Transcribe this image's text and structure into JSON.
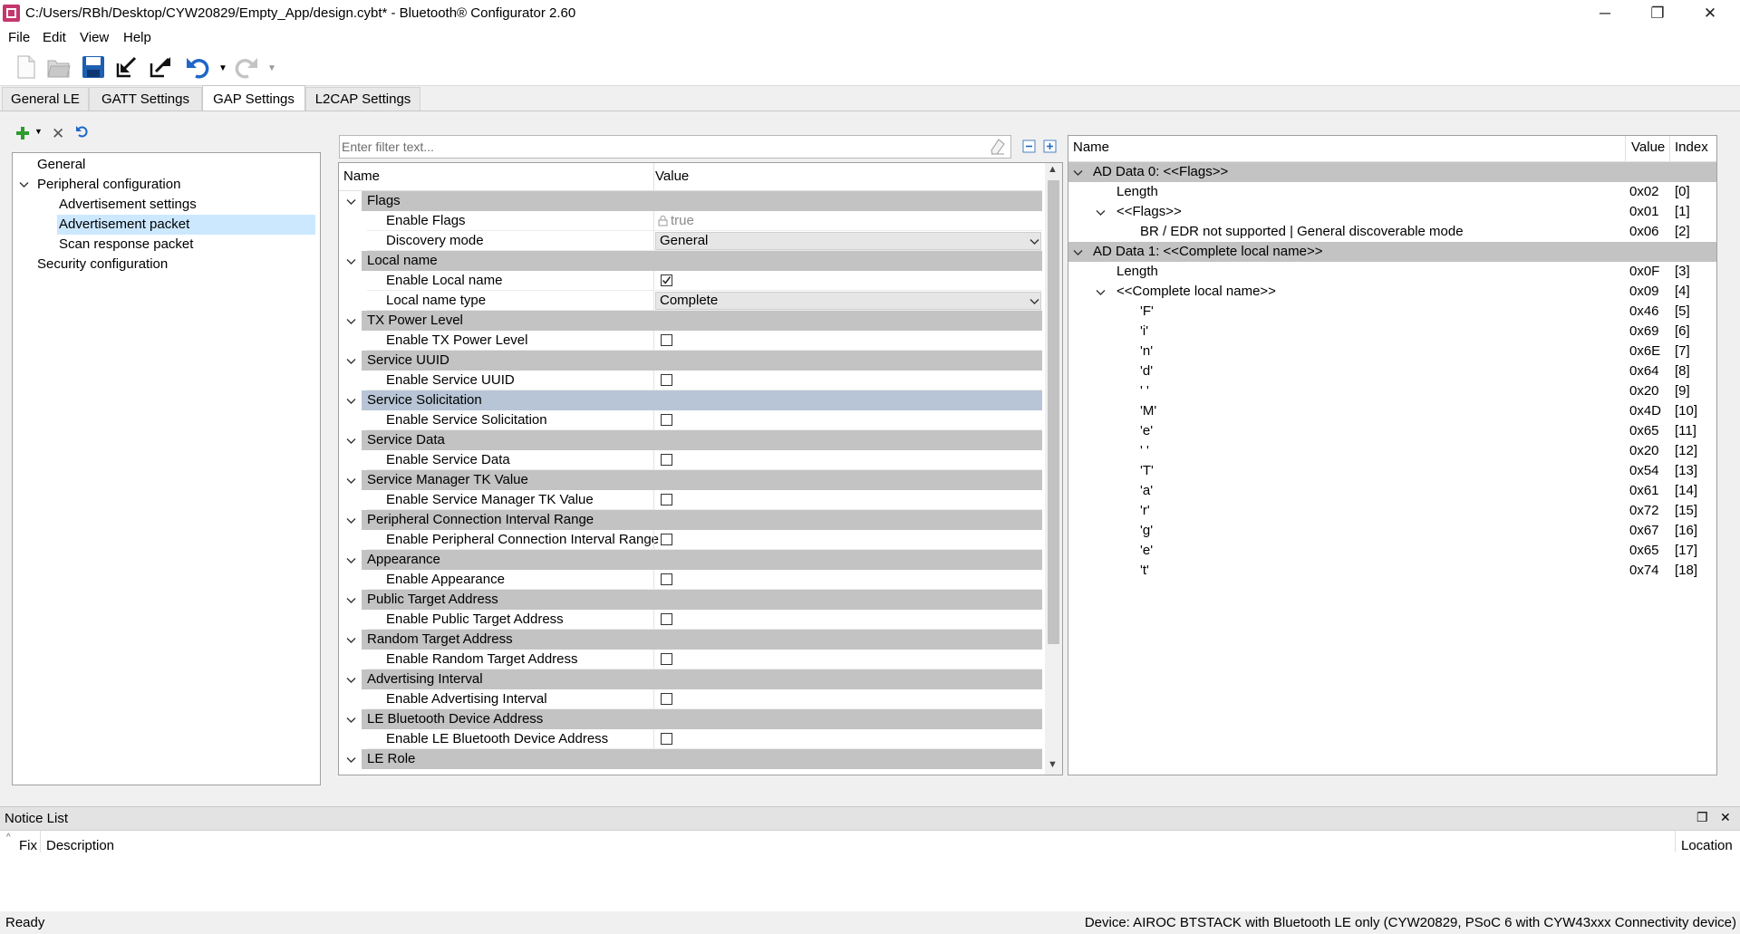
{
  "window": {
    "title": "C:/Users/RBh/Desktop/CYW20829/Empty_App/design.cybt* - Bluetooth® Configurator 2.60",
    "minimize": "─",
    "maximize": "❐",
    "close": "✕"
  },
  "menu": [
    "File",
    "Edit",
    "View",
    "Help"
  ],
  "tabs": [
    {
      "label": "General LE",
      "active": false
    },
    {
      "label": "GATT Settings",
      "active": false
    },
    {
      "label": "GAP Settings",
      "active": true
    },
    {
      "label": "L2CAP Settings",
      "active": false
    }
  ],
  "tree": {
    "items": [
      {
        "label": "General",
        "level": 0,
        "expandable": false,
        "selected": false
      },
      {
        "label": "Peripheral configuration",
        "level": 0,
        "expandable": true,
        "selected": false
      },
      {
        "label": "Advertisement settings",
        "level": 1,
        "expandable": false,
        "selected": false
      },
      {
        "label": "Advertisement packet",
        "level": 1,
        "expandable": false,
        "selected": true
      },
      {
        "label": "Scan response packet",
        "level": 1,
        "expandable": false,
        "selected": false
      },
      {
        "label": "Security configuration",
        "level": 0,
        "expandable": false,
        "selected": false
      }
    ]
  },
  "filter": {
    "placeholder": "Enter filter text..."
  },
  "grid": {
    "header_name": "Name",
    "header_value": "Value",
    "rows": [
      {
        "type": "cat",
        "label": "Flags"
      },
      {
        "type": "prop",
        "label": "Enable Flags",
        "kind": "locked",
        "value": "true"
      },
      {
        "type": "prop",
        "label": "Discovery mode",
        "kind": "dropdown",
        "value": "General"
      },
      {
        "type": "cat",
        "label": "Local name"
      },
      {
        "type": "prop",
        "label": "Enable Local name",
        "kind": "checkbox",
        "checked": true
      },
      {
        "type": "prop",
        "label": "Local name type",
        "kind": "dropdown",
        "value": "Complete"
      },
      {
        "type": "cat",
        "label": "TX Power Level"
      },
      {
        "type": "prop",
        "label": "Enable TX Power Level",
        "kind": "checkbox",
        "checked": false
      },
      {
        "type": "cat",
        "label": "Service UUID"
      },
      {
        "type": "prop",
        "label": "Enable Service UUID",
        "kind": "checkbox",
        "checked": false
      },
      {
        "type": "cat",
        "label": "Service Solicitation",
        "highlight": true
      },
      {
        "type": "prop",
        "label": "Enable Service Solicitation",
        "kind": "checkbox",
        "checked": false
      },
      {
        "type": "cat",
        "label": "Service Data"
      },
      {
        "type": "prop",
        "label": "Enable Service Data",
        "kind": "checkbox",
        "checked": false
      },
      {
        "type": "cat",
        "label": "Service Manager TK Value"
      },
      {
        "type": "prop",
        "label": "Enable Service Manager TK Value",
        "kind": "checkbox",
        "checked": false
      },
      {
        "type": "cat",
        "label": "Peripheral Connection Interval Range"
      },
      {
        "type": "prop",
        "label": "Enable Peripheral Connection Interval Range",
        "kind": "checkbox",
        "checked": false
      },
      {
        "type": "cat",
        "label": "Appearance"
      },
      {
        "type": "prop",
        "label": "Enable Appearance",
        "kind": "checkbox",
        "checked": false
      },
      {
        "type": "cat",
        "label": "Public Target Address"
      },
      {
        "type": "prop",
        "label": "Enable Public Target Address",
        "kind": "checkbox",
        "checked": false
      },
      {
        "type": "cat",
        "label": "Random Target Address"
      },
      {
        "type": "prop",
        "label": "Enable Random Target Address",
        "kind": "checkbox",
        "checked": false
      },
      {
        "type": "cat",
        "label": "Advertising Interval"
      },
      {
        "type": "prop",
        "label": "Enable Advertising Interval",
        "kind": "checkbox",
        "checked": false
      },
      {
        "type": "cat",
        "label": "LE Bluetooth Device Address"
      },
      {
        "type": "prop",
        "label": "Enable LE Bluetooth Device Address",
        "kind": "checkbox",
        "checked": false
      },
      {
        "type": "cat",
        "label": "LE Role"
      }
    ]
  },
  "ad_data": {
    "header_name": "Name",
    "header_value": "Value",
    "header_index": "Index",
    "rows": [
      {
        "name": "AD Data 0: <<Flags>>",
        "value": "",
        "index": "",
        "level": 0,
        "group": true,
        "expand": true
      },
      {
        "name": "Length",
        "value": "0x02",
        "index": "[0]",
        "level": 1,
        "group": false,
        "expand": false
      },
      {
        "name": "<<Flags>>",
        "value": "0x01",
        "index": "[1]",
        "level": 1,
        "group": false,
        "expand": true
      },
      {
        "name": "BR / EDR not supported | General discoverable mode",
        "value": "0x06",
        "index": "[2]",
        "level": 2,
        "group": false,
        "expand": false
      },
      {
        "name": "AD Data 1: <<Complete local name>>",
        "value": "",
        "index": "",
        "level": 0,
        "group": true,
        "expand": true
      },
      {
        "name": "Length",
        "value": "0x0F",
        "index": "[3]",
        "level": 1,
        "group": false,
        "expand": false
      },
      {
        "name": "<<Complete local name>>",
        "value": "0x09",
        "index": "[4]",
        "level": 1,
        "group": false,
        "expand": true
      },
      {
        "name": "'F'",
        "value": "0x46",
        "index": "[5]",
        "level": 2,
        "group": false,
        "expand": false
      },
      {
        "name": "'i'",
        "value": "0x69",
        "index": "[6]",
        "level": 2,
        "group": false,
        "expand": false
      },
      {
        "name": "'n'",
        "value": "0x6E",
        "index": "[7]",
        "level": 2,
        "group": false,
        "expand": false
      },
      {
        "name": "'d'",
        "value": "0x64",
        "index": "[8]",
        "level": 2,
        "group": false,
        "expand": false
      },
      {
        "name": "' '",
        "value": "0x20",
        "index": "[9]",
        "level": 2,
        "group": false,
        "expand": false
      },
      {
        "name": "'M'",
        "value": "0x4D",
        "index": "[10]",
        "level": 2,
        "group": false,
        "expand": false
      },
      {
        "name": "'e'",
        "value": "0x65",
        "index": "[11]",
        "level": 2,
        "group": false,
        "expand": false
      },
      {
        "name": "' '",
        "value": "0x20",
        "index": "[12]",
        "level": 2,
        "group": false,
        "expand": false
      },
      {
        "name": "'T'",
        "value": "0x54",
        "index": "[13]",
        "level": 2,
        "group": false,
        "expand": false
      },
      {
        "name": "'a'",
        "value": "0x61",
        "index": "[14]",
        "level": 2,
        "group": false,
        "expand": false
      },
      {
        "name": "'r'",
        "value": "0x72",
        "index": "[15]",
        "level": 2,
        "group": false,
        "expand": false
      },
      {
        "name": "'g'",
        "value": "0x67",
        "index": "[16]",
        "level": 2,
        "group": false,
        "expand": false
      },
      {
        "name": "'e'",
        "value": "0x65",
        "index": "[17]",
        "level": 2,
        "group": false,
        "expand": false
      },
      {
        "name": "'t'",
        "value": "0x74",
        "index": "[18]",
        "level": 2,
        "group": false,
        "expand": false
      }
    ]
  },
  "notice": {
    "title": "Notice List",
    "col_fix": "Fix",
    "col_description": "Description",
    "col_location": "Location"
  },
  "status": {
    "left": "Ready",
    "right": "Device: AIROC BTSTACK with Bluetooth LE only (CYW20829, PSoC 6 with CYW43xxx Connectivity device)"
  },
  "colors": {
    "category_row": "#c3c3c3",
    "highlight_row": "#b8c5d6",
    "selection": "#cce8ff",
    "accent_blue": "#1e66c8"
  },
  "icons": [
    "app-icon",
    "new-file-icon",
    "open-icon",
    "save-icon",
    "import-icon",
    "export-icon",
    "undo-icon",
    "redo-icon",
    "add-icon",
    "delete-icon",
    "refresh-icon",
    "clear-filter-icon",
    "collapse-all-icon",
    "expand-all-icon",
    "chevron-down-icon",
    "lock-icon",
    "restore-icon",
    "close-icon"
  ]
}
